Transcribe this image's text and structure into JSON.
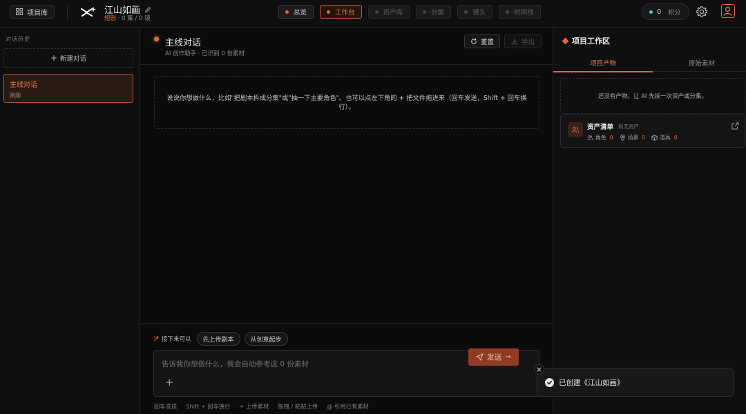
{
  "topbar": {
    "library_label": "项目库",
    "project_name": "江山如画",
    "project_type": "短剧",
    "project_stats": "· 0 集 / 0 镜",
    "nav": [
      {
        "label": "总览",
        "state": "active"
      },
      {
        "label": "工作台",
        "state": "current"
      },
      {
        "label": "资产库",
        "state": "disabled"
      },
      {
        "label": "分集",
        "state": "disabled"
      },
      {
        "label": "镜头",
        "state": "disabled"
      },
      {
        "label": "时间线",
        "state": "disabled"
      }
    ],
    "credits_value": "0",
    "credits_label": "积分"
  },
  "sidebar": {
    "header": "对话历史",
    "new_chat_label": "新建对话",
    "items": [
      {
        "title": "主线对话",
        "time": "刚刚"
      }
    ]
  },
  "chat": {
    "title": "主线对话",
    "subtitle": "AI 创作助手 · 已识别 0 份素材",
    "reset_label": "重置",
    "export_label": "导出",
    "hint": "说说你想做什么，比如\"把剧本拆成分集\"或\"抽一下主要角色\"。也可以点左下角的 + 把文件拖进来（回车发送，Shift + 回车换行）。",
    "next_label": "接下来可以",
    "suggestions": [
      "先上传剧本",
      "从创意起步"
    ],
    "input_placeholder": "告诉我你想做什么，我会自动参考这 0 份素材",
    "send_label": "发送",
    "shortcuts": [
      "回车发送",
      "Shift + 回车换行",
      "+ 上传素材",
      "拖拽 / 粘贴上传",
      "@ 引用已有素材"
    ]
  },
  "workspace": {
    "title": "项目工作区",
    "tabs": [
      "项目产物",
      "原始素材"
    ],
    "active_tab": 0,
    "empty_text": "还没有产物。让 AI 先拆一次资产或分集。",
    "asset_card": {
      "title": "资产清单",
      "status": "尚无资产",
      "stats": [
        {
          "label": "角色",
          "value": "0",
          "icon": "users-icon"
        },
        {
          "label": "场景",
          "value": "0",
          "icon": "map-pin-icon"
        },
        {
          "label": "道具",
          "value": "0",
          "icon": "box-icon"
        }
      ]
    }
  },
  "toast": {
    "message": "已创建《江山如画》"
  },
  "colors": {
    "accent": "#e0673f",
    "background": "#0d0d0e",
    "credit_dot": "#3dd6b6"
  }
}
